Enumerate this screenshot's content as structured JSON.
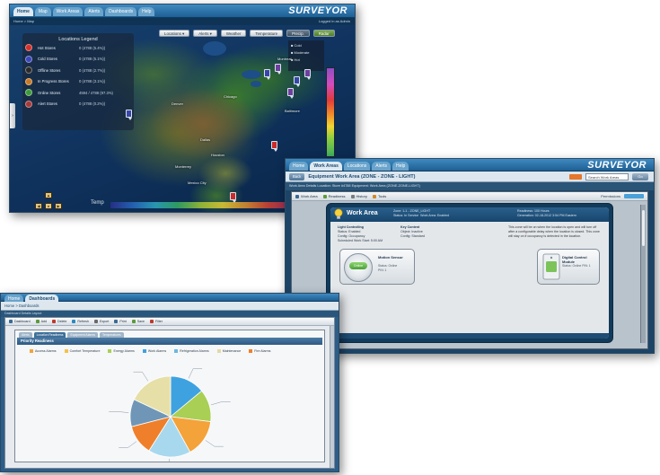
{
  "map_window": {
    "tabs": [
      "Home",
      "Map",
      "Work Areas",
      "Alerts",
      "Dashboards",
      "Help"
    ],
    "active_tab": "Home",
    "brand": "SURVEYOR",
    "subbar_left": "Home > Map",
    "subbar_right": "Logged in as Admin",
    "legend_title": "Locations Legend",
    "legend_items": [
      {
        "label": "Hot Stores",
        "value": "0 (4788 (5.4%))",
        "color": "#d4302c"
      },
      {
        "label": "Cold Stores",
        "value": "0 (4788 (5.1%))",
        "color": "#3c46b8"
      },
      {
        "label": "Offline Stores",
        "value": "0 (4788 (2.7%))",
        "color": "#2b2b2b"
      },
      {
        "label": "In Progress Stores",
        "value": "0 (4788 (3.1%))",
        "color": "#c97a28"
      },
      {
        "label": "Online Stores",
        "value": "4594 / 4788 (97.3%)",
        "color": "#3e9a3a"
      },
      {
        "label": "Alert Stores",
        "value": "0 (4788 (0.2%))",
        "color": "#a53a3a"
      }
    ],
    "controls": [
      "Locations",
      "Alerts",
      "Weather",
      "Temperature",
      "Precip.",
      "Radar"
    ],
    "layers": [
      "Cold",
      "Moderate",
      "Hot"
    ],
    "temp_label": "Temp",
    "map_tags": [
      "Chicago",
      "Denver",
      "Dallas",
      "Houston",
      "Mexico City",
      "Monterrey",
      "Montreal",
      "Baltimore"
    ]
  },
  "work_window": {
    "tabs": [
      "Home",
      "Work Areas",
      "Locations",
      "Alerts",
      "Help"
    ],
    "active_tab": "Work Areas",
    "brand": "SURVEYOR",
    "crumb_button": "Back",
    "crumb_title": "Equipment   Work Area (ZONE - ZONE - LIGHT)",
    "search_placeholder": "Search Work Areas",
    "search_go": "Go",
    "subline": "Work Area Details   Location: Store #4788   Equipment: Work Area (ZONE-ZONE-LIGHT)",
    "toolbar": [
      "Work Area",
      "Readiness",
      "History",
      "Tools"
    ],
    "permission": "Permissions",
    "pane_title": "Work Area",
    "pane_meta_left": "Zone: 1-1 - ZONE_LIGHT\nStatus: In Service  Work Area: Enabled",
    "pane_meta_right": "Readiness: 100 Hours\nGeneration: 02-18-2012 3:54 PM Eastern",
    "info_col1": {
      "head": "Light Controlling",
      "lines": [
        "Status: Enabled",
        "Config: Occupancy",
        "Scheduled Work Start: 5:00 AM"
      ]
    },
    "info_col2": {
      "head": "Key Content",
      "lines": [
        "Object: Inactive",
        "Config: Standard"
      ]
    },
    "info_note": "This zone will be on when the location is open and will turn off after a configurable delay when the location is closed. This zone will stay on if occupancy is detected in the location.",
    "sensor_left": {
      "status": "Online",
      "title": "Motion Sensor",
      "sub": "Status: Online\nPIN: 1"
    },
    "sensor_right": {
      "status": "Online",
      "title": "Digital Control Module",
      "sub": "Status: Online\nPIN: 1"
    }
  },
  "dash_window": {
    "tabs": [
      "Home",
      "Dashboards"
    ],
    "active_tab": "Dashboards",
    "crumb": "Home > Dashboards",
    "subline": "Dashboard Details   Layout",
    "toolbar": [
      "Dashboard",
      "Add",
      "Delete",
      "Refresh",
      "Export",
      "Print",
      "Save",
      "Filter"
    ],
    "panel_tabs": [
      "Alerts",
      "Location Readiness",
      "Equipment Alarms",
      "Temperatures"
    ],
    "panel_title": "Priority Readiness",
    "legend": [
      {
        "label": "Access Alarms",
        "color": "#f3a43a"
      },
      {
        "label": "Comfort Temperature",
        "color": "#f4c24a"
      },
      {
        "label": "Energy Alarms",
        "color": "#a9cf54"
      },
      {
        "label": "Work Alarms",
        "color": "#3fa2e0"
      },
      {
        "label": "Refrigeration Alarms",
        "color": "#6bb8e0"
      },
      {
        "label": "Maintenance",
        "color": "#e5d9a3"
      },
      {
        "label": "Fire Alarms",
        "color": "#ef7f2a"
      }
    ]
  },
  "chart_data": {
    "type": "pie",
    "title": "Priority Readiness",
    "slices": [
      {
        "color": "#3fa2e0",
        "value": 14
      },
      {
        "color": "#a9cf54",
        "value": 13
      },
      {
        "color": "#f4a23a",
        "value": 15
      },
      {
        "color": "#a8d8ee",
        "value": 17
      },
      {
        "color": "#ef7f2a",
        "value": 12
      },
      {
        "color": "#6f96b7",
        "value": 11
      },
      {
        "color": "#e6dfa8",
        "value": 18
      }
    ]
  }
}
